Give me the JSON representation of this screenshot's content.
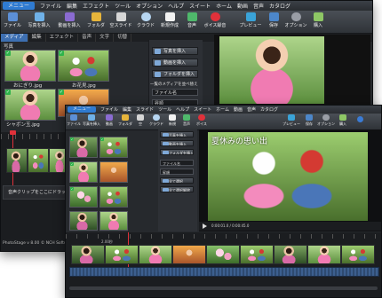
{
  "back_window": {
    "menubar": {
      "app_button": "メニュー",
      "items": [
        "ファイル",
        "編集",
        "エフェクト",
        "ツール",
        "オプション",
        "ヘルプ",
        "スイート",
        "ホーム",
        "動画",
        "音声",
        "カタログ",
        "ヘルプ"
      ]
    },
    "toolbar": [
      "ファイル",
      "写真を挿入",
      "動画を挿入",
      "フォルダ",
      "空スライド",
      "クラウド",
      "新規作成",
      "音声",
      "ボイス録音",
      "プレビュー",
      "保存",
      "オプション",
      "購入"
    ],
    "tabs": [
      "メディア",
      "編集",
      "エフェクト",
      "音声",
      "文字",
      "切替"
    ],
    "section_label": "写真",
    "thumbnails": [
      {
        "caption": "おにぎり.jpg",
        "checked": true
      },
      {
        "caption": "お花見.jpg",
        "checked": true
      },
      {
        "caption": "シャボン玉.jpg",
        "checked": true
      },
      {
        "caption": "",
        "checked": true
      }
    ],
    "side_buttons": [
      "写真を挿入",
      "動画を挿入",
      "フォルダを挿入"
    ],
    "side_label": "一覧のメディアを並べ替え",
    "sort_select": "ファイル名",
    "order_select": "昇順",
    "sound_clip_text": "音声クリップをここにドラッグ",
    "statusbar": "PhotoStage v 8.00 © NCH Software"
  },
  "front_window": {
    "menubar": {
      "app_button": "メニュー",
      "items": [
        "ファイル",
        "編集",
        "スライド",
        "ツール",
        "ヘルプ",
        "スイート",
        "ホーム",
        "動画",
        "音声",
        "カタログ",
        "ヘルプ"
      ]
    },
    "toolbar": [
      "ファイル",
      "写真を挿入",
      "動画",
      "フォルダ",
      "空",
      "クラウド",
      "新規",
      "音声",
      "ボイス",
      "プレビュー",
      "保存",
      "オプション",
      "購入"
    ],
    "side_buttons": [
      "写真を挿入",
      "動画を挿入",
      "フォルダを挿入"
    ],
    "preview_title": "夏休みの思い出",
    "selects": [
      "ファイル名",
      "昇順"
    ],
    "small_buttons": [
      "全て選択",
      "全て選択解除"
    ],
    "playback_time": "0:00:01.0 / 0:00:45.0",
    "timeline_label": "2.00秒"
  },
  "colors": {
    "window_bg": "#26292d",
    "accent": "#2f7bd1",
    "timeline_red": "#e0313a"
  }
}
